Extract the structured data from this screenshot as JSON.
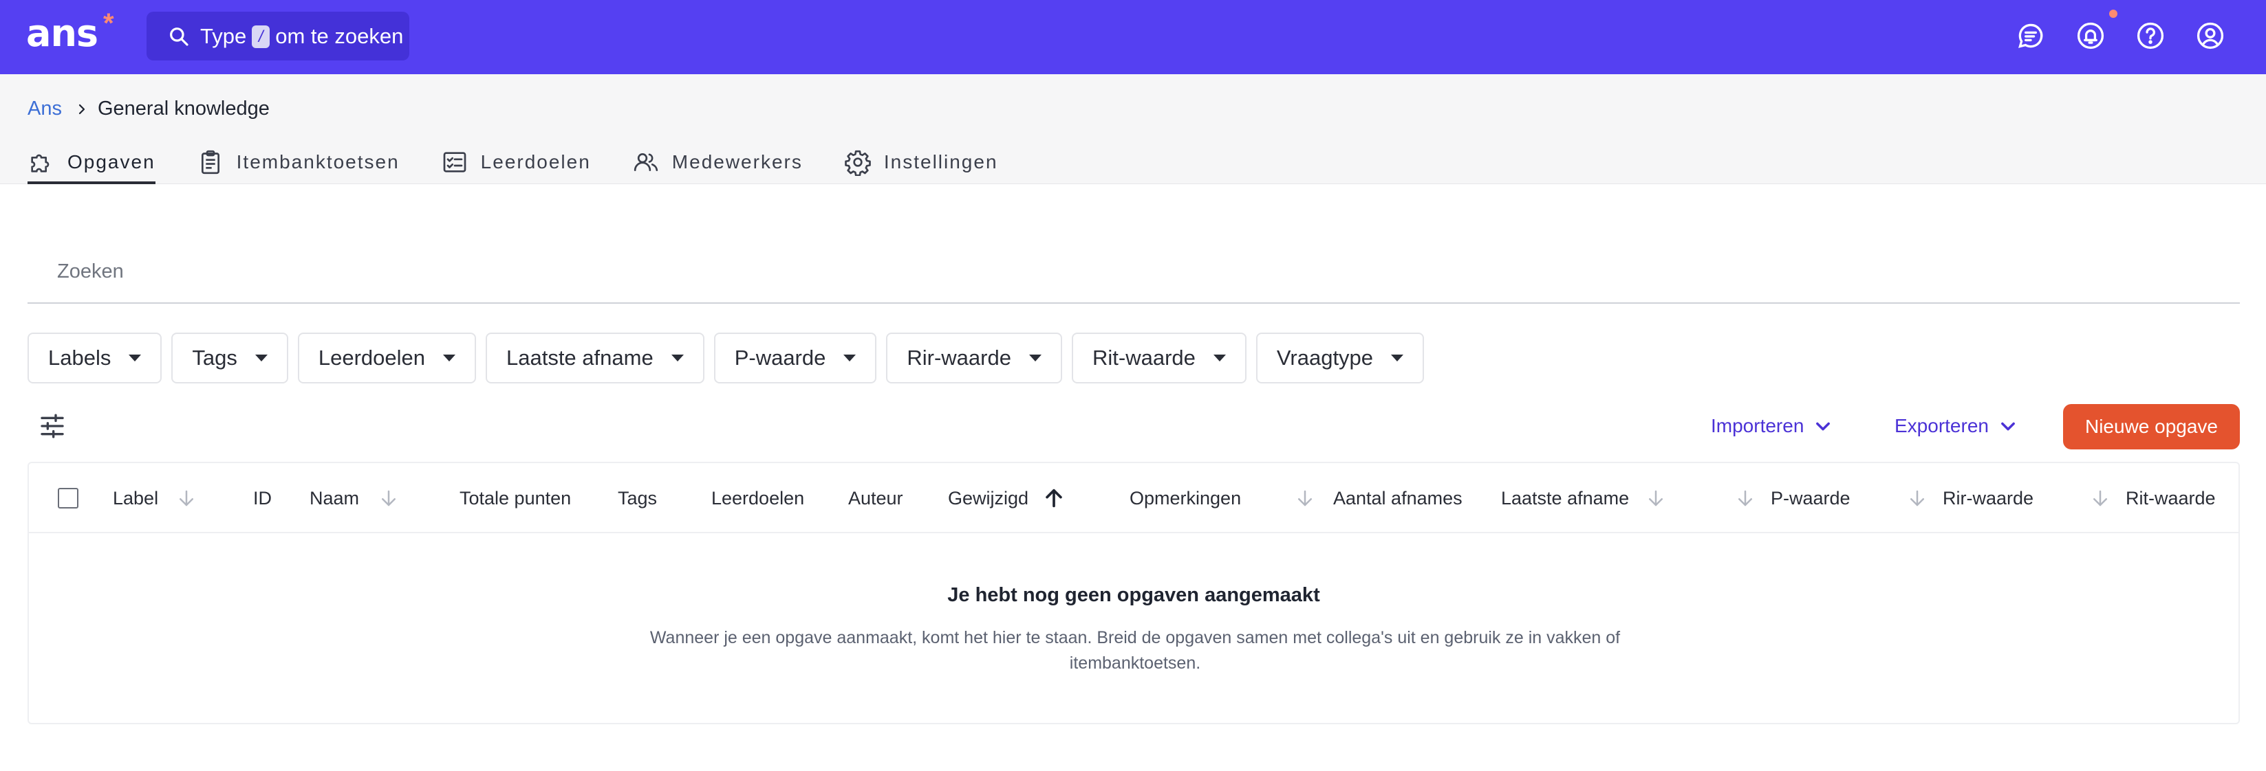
{
  "topbar": {
    "logo_text": "ans",
    "logo_star": "*",
    "search": {
      "prefix": "Type",
      "shortcut_key": "/",
      "suffix": "om te zoeken"
    },
    "icons": [
      "chat-icon",
      "bell-icon",
      "help-icon",
      "user-icon"
    ],
    "accent_color": "#5540f2",
    "notification_dot_color": "#ff8a72"
  },
  "breadcrumb": {
    "root": "Ans",
    "current": "General knowledge"
  },
  "tabs": [
    {
      "label": "Opgaven",
      "icon": "puzzle-icon",
      "active": true
    },
    {
      "label": "Itembanktoetsen",
      "icon": "clipboard-icon",
      "active": false
    },
    {
      "label": "Leerdoelen",
      "icon": "checklist-icon",
      "active": false
    },
    {
      "label": "Medewerkers",
      "icon": "users-icon",
      "active": false
    },
    {
      "label": "Instellingen",
      "icon": "gear-icon",
      "active": false
    }
  ],
  "search": {
    "placeholder": "Zoeken"
  },
  "filters": [
    "Labels",
    "Tags",
    "Leerdoelen",
    "Laatste afname",
    "P-waarde",
    "Rir-waarde",
    "Rit-waarde",
    "Vraagtype"
  ],
  "toolbar": {
    "import_label": "Importeren",
    "export_label": "Exporteren",
    "new_label": "Nieuwe opgave",
    "primary_color": "#e4532e"
  },
  "table": {
    "columns": [
      {
        "label": "Label",
        "sort": "down"
      },
      {
        "label": "ID",
        "sort": "none"
      },
      {
        "label": "Naam",
        "sort": "down"
      },
      {
        "label": "Totale punten",
        "sort": "none"
      },
      {
        "label": "Tags",
        "sort": "none"
      },
      {
        "label": "Leerdoelen",
        "sort": "none"
      },
      {
        "label": "Auteur",
        "sort": "none"
      },
      {
        "label": "Gewijzigd",
        "sort": "up-active"
      },
      {
        "label": "Opmerkingen",
        "sort": "none"
      },
      {
        "label": "Aantal afnames",
        "sort": "down"
      },
      {
        "label": "Laatste afname",
        "sort": "down"
      },
      {
        "label": "P-waarde",
        "sort": "down"
      },
      {
        "label": "Rir-waarde",
        "sort": "down"
      },
      {
        "label": "Rit-waarde",
        "sort": "down"
      }
    ],
    "empty_title": "Je hebt nog geen opgaven aangemaakt",
    "empty_description": "Wanneer je een opgave aanmaakt, komt het hier te staan. Breid de opgaven samen met collega's uit en gebruik ze in vakken of itembanktoetsen."
  }
}
